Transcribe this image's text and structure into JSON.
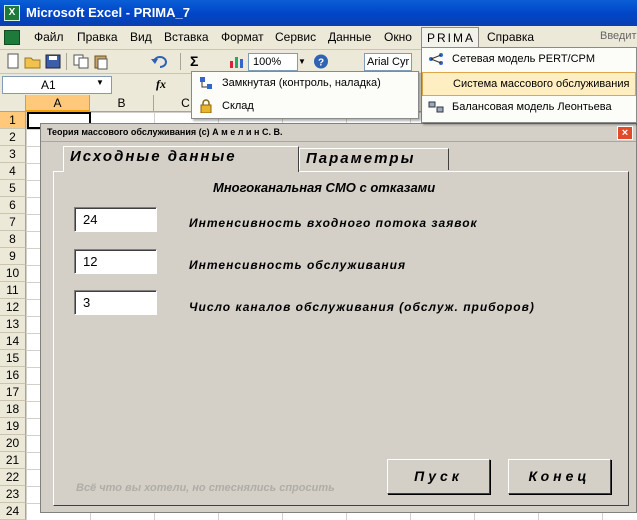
{
  "window": {
    "title": "Microsoft Excel - PRIMA_7",
    "app_icon_glyph": "X"
  },
  "menu": {
    "items": [
      "Файл",
      "Правка",
      "Вид",
      "Вставка",
      "Формат",
      "Сервис",
      "Данные",
      "Окно",
      "PRIMA",
      "Справка"
    ],
    "search_placeholder": "Введит"
  },
  "toolbar": {
    "zoom": "100%",
    "font": "Arial Cyr",
    "sigma": "Σ"
  },
  "formula_bar": {
    "name_box": "A1",
    "fx": "fx"
  },
  "grid": {
    "columns": [
      "A",
      "B",
      "C"
    ],
    "rows": [
      "1",
      "2",
      "3",
      "4",
      "5",
      "6",
      "7",
      "8",
      "9",
      "10",
      "11",
      "12",
      "13",
      "14",
      "15",
      "16",
      "17",
      "18",
      "19",
      "20",
      "21",
      "22",
      "23",
      "24"
    ]
  },
  "prima_menu": {
    "items": [
      "Сетевая модель PERT/CPM",
      "Система массового обслуживания",
      "Балансовая модель Леонтьева"
    ]
  },
  "sub_menu": {
    "items": [
      "Замкнутая (контроль, наладка)",
      "Склад"
    ]
  },
  "dialog": {
    "title": "Теория массового обслуживания (c) А м е л и н  С. В.",
    "close_glyph": "×",
    "tabs": [
      "Исходные  данные",
      "Параметры"
    ],
    "heading": "Многоканальная СМО с отказами",
    "fields": [
      {
        "value": "24",
        "label": "Интенсивность  входного  потока  заявок"
      },
      {
        "value": "12",
        "label": "Интенсивность обслуживания"
      },
      {
        "value": "3",
        "label": "Число  каналов  обслуживания (обслуж.  приборов)"
      }
    ],
    "footnote": "Всё что вы хотели, но стеснялись спросить",
    "buttons": {
      "start": "Пуск",
      "end": "Конец"
    }
  },
  "colors": {
    "titlebar": "#0046c8",
    "highlight": "#ffeec2",
    "close": "#e24a2c",
    "dialog_bg": "#d4d0c8"
  }
}
